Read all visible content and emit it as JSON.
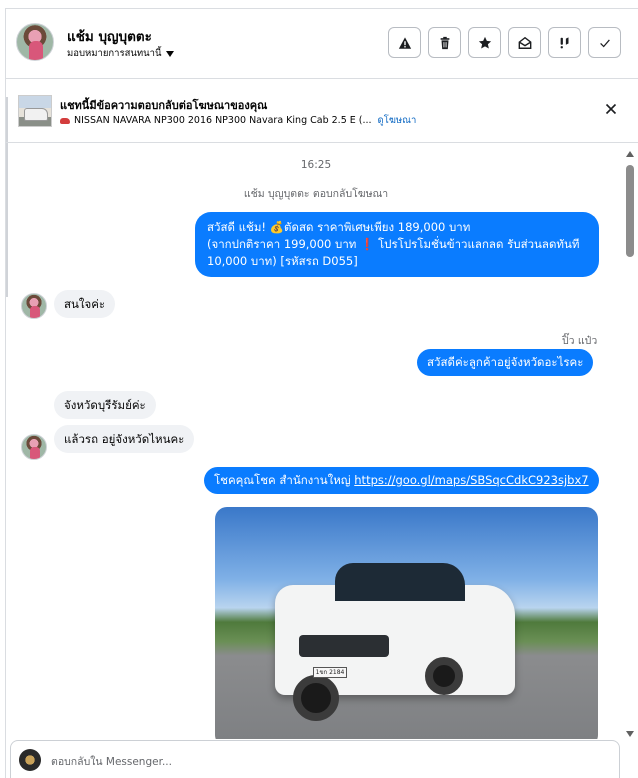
{
  "header": {
    "name": "แช้ม บุญบุตตะ",
    "assign_label": "มอบหมายการสนทนานี้",
    "actions": [
      {
        "icon": "warning-icon"
      },
      {
        "icon": "trash-icon"
      },
      {
        "icon": "star-icon"
      },
      {
        "icon": "mark-unread-icon"
      },
      {
        "icon": "follow-up-icon"
      },
      {
        "icon": "check-icon"
      }
    ]
  },
  "ad": {
    "title": "แชทนี้มีข้อความตอบกลับต่อโฆษณาของคุณ",
    "description": "NISSAN NAVARA NP300 2016 NP300 Navara King Cab 2.5 E (...",
    "link": "ดูโฆษณา"
  },
  "chat": {
    "time": "16:25",
    "replied_note": "แช้ม บุญบุตตะ ตอบกลับโฆษณา",
    "msg1_line1": "สวัสดี แช้ม! 💰ตัดสด ราคาพิเศษเพียง 189,000 บาท",
    "msg1_line2": "(จากปกติราคา 199,000 บาท ❗️ โปรโปรโมชั่นข้าวแลกลด รับส่วนลดทันที",
    "msg1_line3": "10,000 บาท) [รหัสรถ D055]",
    "msg2": "สนใจค่ะ",
    "page_sender": "ปิ๊ว แป๋ว",
    "msg3": "สวัสดีค่ะลูกค้าอยู่จังหวัดอะไรคะ",
    "msg4": "จังหวัดบุรีรัมย์ค่ะ",
    "msg5": "แล้วรถ อยู่จังหวัดไหนคะ",
    "msg6_text": "โชคคุณโชค สำนักงานใหญ่",
    "msg6_link": "https://goo.gl/maps/SBSqcCdkC923sjbx7",
    "plate_text": "1ขก 2184"
  },
  "composer": {
    "placeholder": "ตอบกลับใน Messenger..."
  }
}
